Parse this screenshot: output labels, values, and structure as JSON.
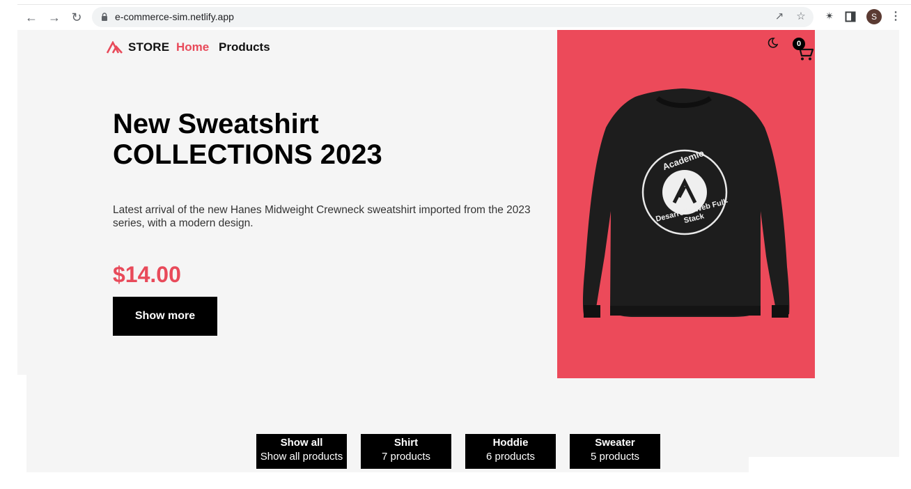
{
  "browser": {
    "url": "e-commerce-sim.netlify.app",
    "profile_initial": "S",
    "icons": [
      "back-arrow-icon",
      "forward-arrow-icon",
      "reload-icon",
      "lock-icon",
      "share-icon",
      "star-icon",
      "extensions-icon",
      "side-panel-icon",
      "menu-dots-icon"
    ]
  },
  "nav": {
    "brand": "STORE",
    "home": "Home",
    "products": "Products",
    "cart_count": "0"
  },
  "hero": {
    "title_line1": "New Sweatshirt",
    "title_line2": "COLLECTIONS 2023",
    "description": "Latest arrival of the new Hanes Midweight Crewneck sweatshirt imported from the 2023 series, with a modern design.",
    "price": "$14.00",
    "button": "Show more",
    "print_top": "Academlo",
    "print_bottom": "Desarrollo Web Full-Stack"
  },
  "categories": [
    {
      "name": "Show all",
      "count": "Show all products"
    },
    {
      "name": "Shirt",
      "count": "7 products"
    },
    {
      "name": "Hoddie",
      "count": "6 products"
    },
    {
      "name": "Sweater",
      "count": "5 products"
    }
  ],
  "colors": {
    "accent": "#e84a5a",
    "hero_bg": "#ec4a5a",
    "page_bg": "#f5f5f5",
    "button_bg": "#000000"
  }
}
